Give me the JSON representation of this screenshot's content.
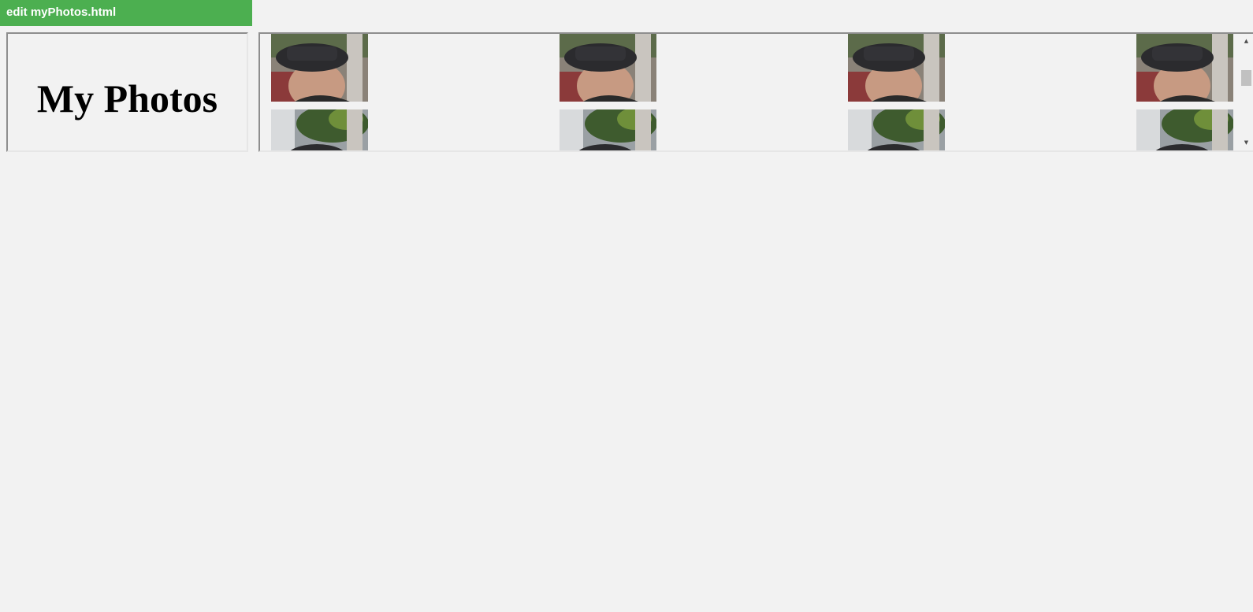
{
  "edit_link": {
    "label": "edit myPhotos.html"
  },
  "header": {
    "title": "My Photos"
  },
  "gallery": {
    "rows": [
      {
        "photo": "selfie-hat",
        "count": 4
      },
      {
        "photo": "hat-with-trees",
        "count": 4
      }
    ]
  },
  "colors": {
    "edit_bar": "#4caf50",
    "page_bg": "#f2f2f2"
  },
  "scrollbar": {
    "up_icon": "caret-up-icon",
    "down_icon": "caret-down-icon"
  }
}
